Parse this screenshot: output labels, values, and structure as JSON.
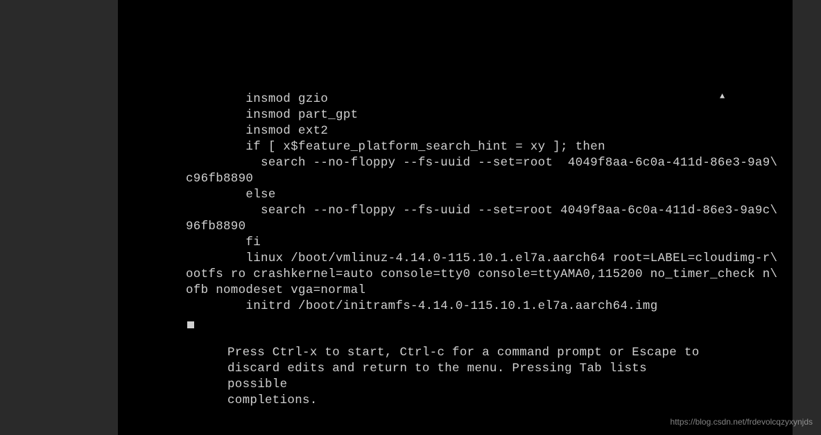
{
  "grub_editor": {
    "lines": [
      "        insmod gzio",
      "        insmod part_gpt",
      "        insmod ext2",
      "        if [ x$feature_platform_search_hint = xy ]; then",
      "          search --no-floppy --fs-uuid --set=root  4049f8aa-6c0a-411d-86e3-9a9\\",
      "c96fb8890",
      "        else",
      "          search --no-floppy --fs-uuid --set=root 4049f8aa-6c0a-411d-86e3-9a9c\\",
      "96fb8890",
      "        fi",
      "        linux /boot/vmlinuz-4.14.0-115.10.1.el7a.aarch64 root=LABEL=cloudimg-r\\",
      "ootfs ro crashkernel=auto console=tty0 console=ttyAMA0,115200 no_timer_check n\\",
      "ofb nomodeset vga=normal",
      "        initrd /boot/initramfs-4.14.0-115.10.1.el7a.aarch64.img"
    ],
    "scroll_up_indicator": "▲",
    "help": "Press Ctrl-x to start, Ctrl-c for a command prompt or Escape to\ndiscard edits and return to the menu. Pressing Tab lists possible\ncompletions."
  },
  "watermark": "https://blog.csdn.net/frdevolcqzyxynjds"
}
